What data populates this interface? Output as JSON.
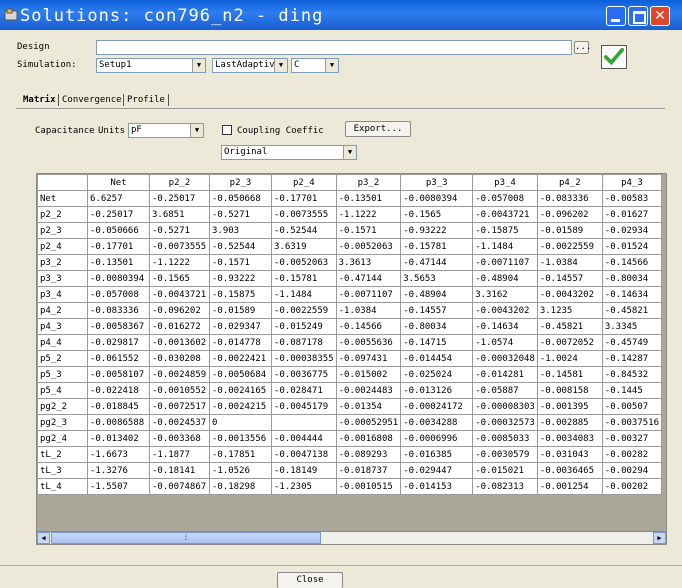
{
  "window": {
    "title": "Solutions: con796_n2 - ding"
  },
  "form": {
    "design_label": "Design",
    "design_value": "",
    "simulation_label": "Simulation:",
    "setup_value": "Setup1",
    "adaptive_value": "LastAdaptiv",
    "c_value": "C",
    "browse_label": "..."
  },
  "tabs": [
    {
      "label": "Matrix",
      "active": true
    },
    {
      "label": "Convergence",
      "active": false
    },
    {
      "label": "Profile",
      "active": false
    }
  ],
  "matrix": {
    "capacitance_label": "Capacitance",
    "units_label": "Units",
    "units_value": "pF",
    "coupling_label": "Coupling Coeffic",
    "export_label": "Export...",
    "view_value": "Original"
  },
  "grid": {
    "columns": [
      "Net",
      "p2_2",
      "p2_3",
      "p2_4",
      "p3_2",
      "p3_3",
      "p3_4",
      "p4_2",
      "p4_3"
    ],
    "rows": [
      {
        "name": "Net",
        "cells": [
          "6.6257",
          "-0.25017",
          "-0.050668",
          "-0.17701",
          "-0.13501",
          "-0.0080394",
          "-0.057008",
          "-0.083336",
          "-0.00583"
        ]
      },
      {
        "name": "p2_2",
        "cells": [
          "-0.25017",
          "3.6851",
          "-0.5271",
          "-0.0073555",
          "-1.1222",
          "-0.1565",
          "-0.0043721",
          "-0.096202",
          "-0.01627"
        ]
      },
      {
        "name": "p2_3",
        "cells": [
          "-0.050666",
          "-0.5271",
          "3.903",
          "-0.52544",
          "-0.1571",
          "-0.93222",
          "-0.15875",
          "-0.01589",
          "-0.02934"
        ]
      },
      {
        "name": "p2_4",
        "cells": [
          "-0.17701",
          "-0.0073555",
          "-0.52544",
          "3.6319",
          "-0.0052063",
          "-0.15781",
          "-1.1484",
          "-0.0022559",
          "-0.01524"
        ]
      },
      {
        "name": "p3_2",
        "cells": [
          "-0.13501",
          "-1.1222",
          "-0.1571",
          "-0.0052063",
          "3.3613",
          "-0.47144",
          "-0.0071107",
          "-1.0384",
          "-0.14566"
        ]
      },
      {
        "name": "p3_3",
        "cells": [
          "-0.0080394",
          "-0.1565",
          "-0.93222",
          "-0.15781",
          "-0.47144",
          "3.5653",
          "-0.48904",
          "-0.14557",
          "-0.80034"
        ]
      },
      {
        "name": "p3_4",
        "cells": [
          "-0.057008",
          "-0.0043721",
          "-0.15875",
          "-1.1484",
          "-0.0071107",
          "-0.48904",
          "3.3162",
          "-0.0043202",
          "-0.14634"
        ]
      },
      {
        "name": "p4_2",
        "cells": [
          "-0.083336",
          "-0.096202",
          "-0.01589",
          "-0.0022559",
          "-1.0384",
          "-0.14557",
          "-0.0043202",
          "3.1235",
          "-0.45821"
        ]
      },
      {
        "name": "p4_3",
        "cells": [
          "-0.0058367",
          "-0.016272",
          "-0.029347",
          "-0.015249",
          "-0.14566",
          "-0.80034",
          "-0.14634",
          "-0.45821",
          "3.3345"
        ]
      },
      {
        "name": "p4_4",
        "cells": [
          "-0.029817",
          "-0.0013602",
          "-0.014778",
          "-0.087178",
          "-0.0055636",
          "-0.14715",
          "-1.0574",
          "-0.0072052",
          "-0.45749"
        ]
      },
      {
        "name": "p5_2",
        "cells": [
          "-0.061552",
          "-0.030208",
          "-0.0022421",
          "-0.00038355",
          "-0.097431",
          "-0.014454",
          "-0.00032048",
          "-1.0024",
          "-0.14287"
        ]
      },
      {
        "name": "p5_3",
        "cells": [
          "-0.0058107",
          "-0.0024859",
          "-0.0050684",
          "-0.0036775",
          "-0.015002",
          "-0.025024",
          "-0.014281",
          "-0.14581",
          "-0.84532"
        ]
      },
      {
        "name": "p5_4",
        "cells": [
          "-0.022418",
          "-0.0010552",
          "-0.0024165",
          "-0.028471",
          "-0.0024483",
          "-0.013126",
          "-0.05887",
          "-0.008158",
          "-0.1445"
        ]
      },
      {
        "name": "pg2_2",
        "cells": [
          "-0.018845",
          "-0.0072517",
          "-0.0024215",
          "-0.0045179",
          "-0.01354",
          "-0.00024172",
          "-0.00008303",
          "-0.001395",
          "-0.00507"
        ]
      },
      {
        "name": "pg2_3",
        "cells": [
          "-0.0086588",
          "-0.0024537",
          "0",
          "",
          "-0.00052951",
          "-0.0034288",
          "-0.00032573",
          "-0.002885",
          "-0.0037516"
        ]
      },
      {
        "name": "pg2_4",
        "cells": [
          "-0.013402",
          "-0.003368",
          "-0.0013556",
          "-0.004444",
          "-0.0016808",
          "-0.0006996",
          "-0.0085033",
          "-0.0034083",
          "-0.00327"
        ]
      },
      {
        "name": "tL_2",
        "cells": [
          "-1.6673",
          "-1.1877",
          "-0.17851",
          "-0.0047138",
          "-0.089293",
          "-0.016385",
          "-0.0030579",
          "-0.031043",
          "-0.00282"
        ]
      },
      {
        "name": "tL_3",
        "cells": [
          "-1.3276",
          "-0.18141",
          "-1.0526",
          "-0.18149",
          "-0.018737",
          "-0.029447",
          "-0.015021",
          "-0.0036465",
          "-0.00294"
        ]
      },
      {
        "name": "tL_4",
        "cells": [
          "-1.5507",
          "-0.0074867",
          "-0.18298",
          "-1.2305",
          "-0.0010515",
          "-0.014153",
          "-0.082313",
          "-0.001254",
          "-0.00202"
        ]
      }
    ]
  },
  "footer": {
    "close_label": "Close"
  },
  "colors": {
    "title_bar": "#1a5fd0",
    "grid_bg": "#aca899",
    "confirm": "#2fa82f"
  },
  "icons": {
    "app": "app-icon",
    "confirm": "checkmark-icon"
  }
}
